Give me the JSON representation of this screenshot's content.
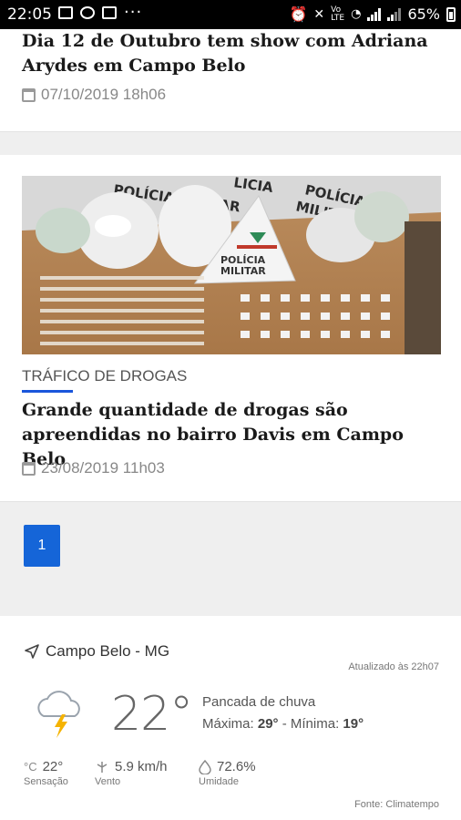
{
  "status_bar": {
    "time": "22:05",
    "dots": "···",
    "battery": "65%"
  },
  "articles": [
    {
      "title": "Dia 12 de Outubro tem show com Adriana Arydes em Campo Belo",
      "date": "07/10/2019 18h06"
    },
    {
      "image_alt": "Apreensão de drogas - Polícia Militar",
      "image_text": "POLÍCIA MILITAR",
      "category": "TRÁFICO DE DROGAS",
      "title": "Grande quantidade de drogas são apreendidas no bairro Davis em Campo Belo",
      "date": "23/08/2019 11h03"
    }
  ],
  "pagination": {
    "current": "1"
  },
  "weather": {
    "location": "Campo Belo - MG",
    "updated": "Atualizado às 22h07",
    "temperature": "22°",
    "description": "Pancada de chuva",
    "max_label": "Máxima:",
    "max": "29°",
    "separator": " - ",
    "min_label": "Mínima:",
    "min": "19°",
    "feels_like": "22°",
    "feels_like_label": "Sensação",
    "wind": "5.9 km/h",
    "wind_label": "Vento",
    "humidity": "72.6%",
    "humidity_label": "Umidade",
    "source_label": "Fonte:",
    "source": "Climatempo",
    "icon": "storm-cloud-icon"
  },
  "colors": {
    "accent": "#1565d8",
    "category_underline": "#1a56db",
    "background": "#efefef"
  }
}
